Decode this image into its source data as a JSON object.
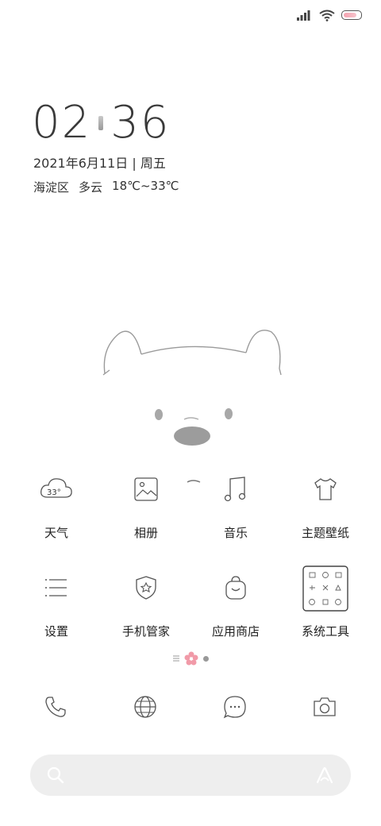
{
  "status": {
    "signal": "signal-icon",
    "wifi": "wifi-icon",
    "battery_level": 0.8
  },
  "clock": {
    "hour": "02",
    "minute": "36"
  },
  "date": {
    "text": "2021年6月11日 | 周五"
  },
  "weather": {
    "district": "海淀区",
    "condition": "多云",
    "range": "18℃~33℃"
  },
  "apps": [
    {
      "label": "天气",
      "temp": "33°"
    },
    {
      "label": "相册"
    },
    {
      "label": "音乐"
    },
    {
      "label": "主题壁纸"
    },
    {
      "label": "设置"
    },
    {
      "label": "手机管家"
    },
    {
      "label": "应用商店"
    },
    {
      "label": "系统工具"
    }
  ],
  "dock": [
    "phone-icon",
    "browser-icon",
    "messages-icon",
    "camera-icon"
  ],
  "search": {
    "placeholder": ""
  },
  "colors": {
    "battery": "#f3a3b0",
    "pager_flower": "#f19aa8",
    "search_bg": "#eeeeee"
  }
}
